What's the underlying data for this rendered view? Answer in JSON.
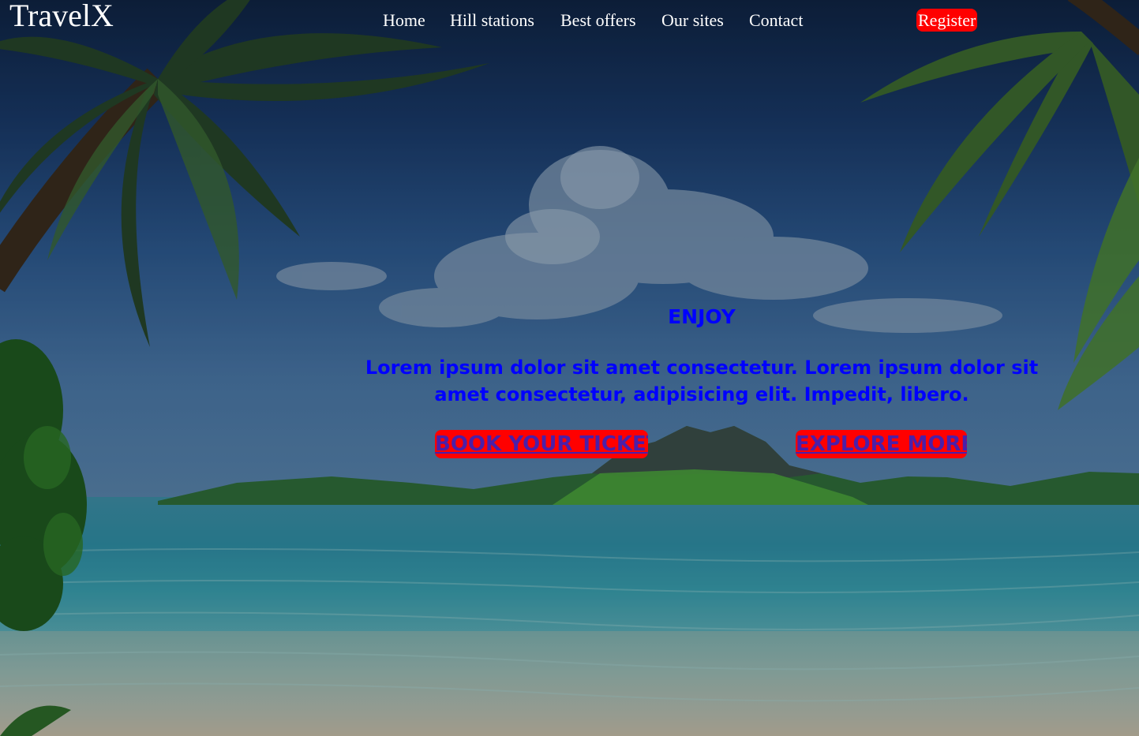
{
  "brand": {
    "logo": "TravelX"
  },
  "nav": {
    "items": [
      {
        "label": "Home"
      },
      {
        "label": "Hill stations"
      },
      {
        "label": "Best offers"
      },
      {
        "label": "Our sites"
      },
      {
        "label": "Contact"
      }
    ],
    "register_label": "Register"
  },
  "hero": {
    "title": "ENJOY",
    "text": "Lorem ipsum dolor sit amet consectetur. Lorem ipsum dolor sit amet consectetur, adipisicing elit. Impedit, libero.",
    "book_label": "BOOK YOUR TICKET",
    "explore_label": "EXPLORE MORE"
  },
  "colors": {
    "accent_red": "#ff0000",
    "hero_text_blue": "#0000ff",
    "button_text_purple": "#4b1fa8",
    "nav_text": "#ffffff"
  }
}
